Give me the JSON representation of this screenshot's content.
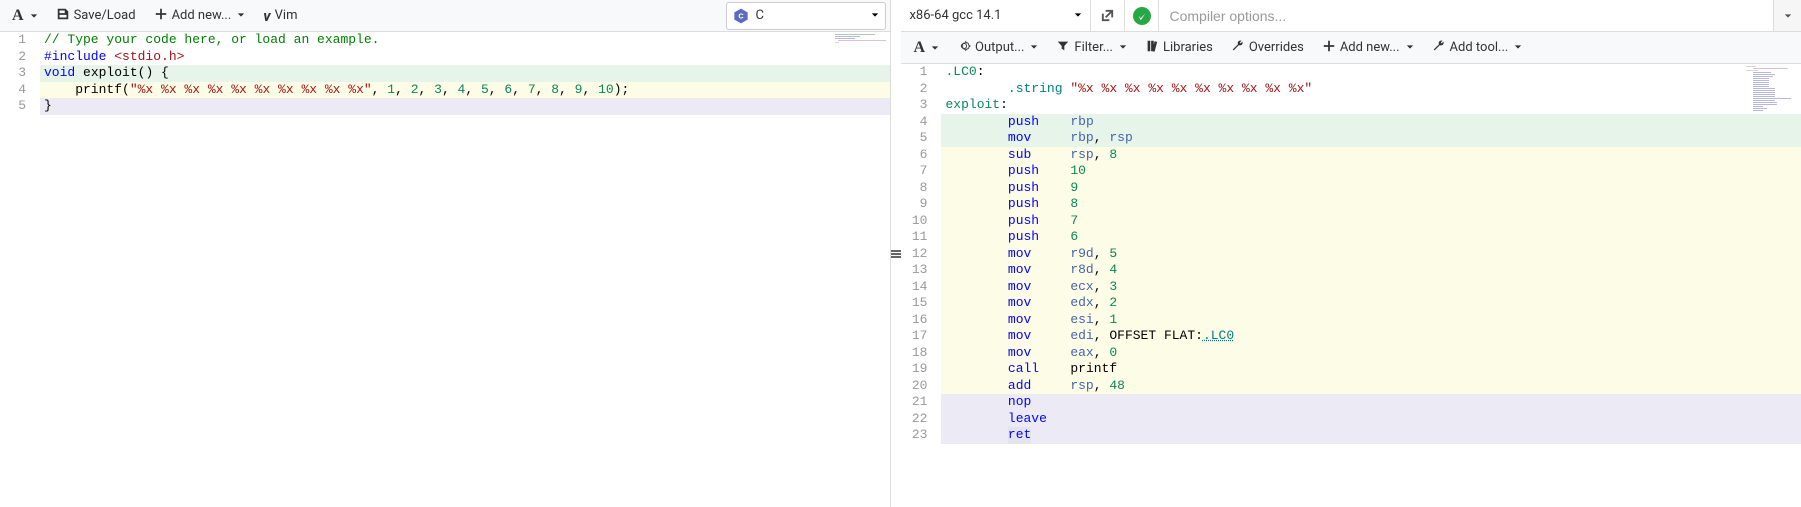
{
  "left": {
    "toolbar": {
      "font_label": "A",
      "saveload": "Save/Load",
      "addnew": "Add new...",
      "vim": "Vim"
    },
    "language": {
      "label": "C"
    },
    "code": {
      "lines": [
        {
          "n": 1,
          "bg": "",
          "tokens": [
            {
              "t": "// Type your code here, or load an example.",
              "c": "tok-comment"
            }
          ]
        },
        {
          "n": 2,
          "bg": "",
          "tokens": [
            {
              "t": "#include ",
              "c": "tok-pp"
            },
            {
              "t": "<stdio.h>",
              "c": "tok-ppfile"
            }
          ]
        },
        {
          "n": 3,
          "bg": "bg-green",
          "tokens": [
            {
              "t": "void",
              "c": "tok-type"
            },
            {
              "t": " ",
              "c": "tok-plain"
            },
            {
              "t": "exploit",
              "c": "tok-func"
            },
            {
              "t": "() {",
              "c": "tok-plain"
            }
          ]
        },
        {
          "n": 4,
          "bg": "bg-yellow",
          "tokens": [
            {
              "t": "    printf(",
              "c": "tok-plain"
            },
            {
              "t": "\"%x %x %x %x %x %x %x %x %x %x\"",
              "c": "tok-string"
            },
            {
              "t": ", ",
              "c": "tok-plain"
            },
            {
              "t": "1",
              "c": "tok-number"
            },
            {
              "t": ", ",
              "c": "tok-plain"
            },
            {
              "t": "2",
              "c": "tok-number"
            },
            {
              "t": ", ",
              "c": "tok-plain"
            },
            {
              "t": "3",
              "c": "tok-number"
            },
            {
              "t": ", ",
              "c": "tok-plain"
            },
            {
              "t": "4",
              "c": "tok-number"
            },
            {
              "t": ", ",
              "c": "tok-plain"
            },
            {
              "t": "5",
              "c": "tok-number"
            },
            {
              "t": ", ",
              "c": "tok-plain"
            },
            {
              "t": "6",
              "c": "tok-number"
            },
            {
              "t": ", ",
              "c": "tok-plain"
            },
            {
              "t": "7",
              "c": "tok-number"
            },
            {
              "t": ", ",
              "c": "tok-plain"
            },
            {
              "t": "8",
              "c": "tok-number"
            },
            {
              "t": ", ",
              "c": "tok-plain"
            },
            {
              "t": "9",
              "c": "tok-number"
            },
            {
              "t": ", ",
              "c": "tok-plain"
            },
            {
              "t": "10",
              "c": "tok-number"
            },
            {
              "t": ");",
              "c": "tok-plain"
            }
          ]
        },
        {
          "n": 5,
          "bg": "bg-purple",
          "tokens": [
            {
              "t": "}",
              "c": "tok-plain"
            }
          ]
        }
      ]
    }
  },
  "right": {
    "compiler": {
      "name": "x86-64 gcc 14.1",
      "options_placeholder": "Compiler options..."
    },
    "toolbar": {
      "font_label": "A",
      "output": "Output...",
      "filter": "Filter...",
      "libraries": "Libraries",
      "overrides": "Overrides",
      "addnew": "Add new...",
      "addtool": "Add tool..."
    },
    "asm": {
      "lines": [
        {
          "n": 1,
          "bg": "",
          "tokens": [
            {
              "t": ".LC0",
              "c": "tok-label"
            },
            {
              "t": ":",
              "c": "tok-plain"
            }
          ]
        },
        {
          "n": 2,
          "bg": "",
          "tokens": [
            {
              "t": "        ",
              "c": "tok-plain"
            },
            {
              "t": ".string",
              "c": "tok-dir"
            },
            {
              "t": " ",
              "c": "tok-plain"
            },
            {
              "t": "\"%x %x %x %x %x %x %x %x %x %x\"",
              "c": "tok-string"
            }
          ]
        },
        {
          "n": 3,
          "bg": "",
          "tokens": [
            {
              "t": "exploit",
              "c": "tok-label"
            },
            {
              "t": ":",
              "c": "tok-plain"
            }
          ]
        },
        {
          "n": 4,
          "bg": "bg-green",
          "tokens": [
            {
              "t": "        ",
              "c": "tok-plain"
            },
            {
              "t": "push",
              "c": "tok-instr"
            },
            {
              "t": "    ",
              "c": "tok-plain"
            },
            {
              "t": "rbp",
              "c": "tok-reg"
            }
          ]
        },
        {
          "n": 5,
          "bg": "bg-green",
          "tokens": [
            {
              "t": "        ",
              "c": "tok-plain"
            },
            {
              "t": "mov",
              "c": "tok-instr"
            },
            {
              "t": "     ",
              "c": "tok-plain"
            },
            {
              "t": "rbp",
              "c": "tok-reg"
            },
            {
              "t": ", ",
              "c": "tok-plain"
            },
            {
              "t": "rsp",
              "c": "tok-reg"
            }
          ]
        },
        {
          "n": 6,
          "bg": "bg-yellow",
          "tokens": [
            {
              "t": "        ",
              "c": "tok-plain"
            },
            {
              "t": "sub",
              "c": "tok-instr"
            },
            {
              "t": "     ",
              "c": "tok-plain"
            },
            {
              "t": "rsp",
              "c": "tok-reg"
            },
            {
              "t": ", ",
              "c": "tok-plain"
            },
            {
              "t": "8",
              "c": "tok-number"
            }
          ]
        },
        {
          "n": 7,
          "bg": "bg-yellow",
          "tokens": [
            {
              "t": "        ",
              "c": "tok-plain"
            },
            {
              "t": "push",
              "c": "tok-instr"
            },
            {
              "t": "    ",
              "c": "tok-plain"
            },
            {
              "t": "10",
              "c": "tok-number"
            }
          ]
        },
        {
          "n": 8,
          "bg": "bg-yellow",
          "tokens": [
            {
              "t": "        ",
              "c": "tok-plain"
            },
            {
              "t": "push",
              "c": "tok-instr"
            },
            {
              "t": "    ",
              "c": "tok-plain"
            },
            {
              "t": "9",
              "c": "tok-number"
            }
          ]
        },
        {
          "n": 9,
          "bg": "bg-yellow",
          "tokens": [
            {
              "t": "        ",
              "c": "tok-plain"
            },
            {
              "t": "push",
              "c": "tok-instr"
            },
            {
              "t": "    ",
              "c": "tok-plain"
            },
            {
              "t": "8",
              "c": "tok-number"
            }
          ]
        },
        {
          "n": 10,
          "bg": "bg-yellow",
          "tokens": [
            {
              "t": "        ",
              "c": "tok-plain"
            },
            {
              "t": "push",
              "c": "tok-instr"
            },
            {
              "t": "    ",
              "c": "tok-plain"
            },
            {
              "t": "7",
              "c": "tok-number"
            }
          ]
        },
        {
          "n": 11,
          "bg": "bg-yellow",
          "tokens": [
            {
              "t": "        ",
              "c": "tok-plain"
            },
            {
              "t": "push",
              "c": "tok-instr"
            },
            {
              "t": "    ",
              "c": "tok-plain"
            },
            {
              "t": "6",
              "c": "tok-number"
            }
          ]
        },
        {
          "n": 12,
          "bg": "bg-yellow",
          "tokens": [
            {
              "t": "        ",
              "c": "tok-plain"
            },
            {
              "t": "mov",
              "c": "tok-instr"
            },
            {
              "t": "     ",
              "c": "tok-plain"
            },
            {
              "t": "r9d",
              "c": "tok-reg"
            },
            {
              "t": ", ",
              "c": "tok-plain"
            },
            {
              "t": "5",
              "c": "tok-number"
            }
          ]
        },
        {
          "n": 13,
          "bg": "bg-yellow",
          "tokens": [
            {
              "t": "        ",
              "c": "tok-plain"
            },
            {
              "t": "mov",
              "c": "tok-instr"
            },
            {
              "t": "     ",
              "c": "tok-plain"
            },
            {
              "t": "r8d",
              "c": "tok-reg"
            },
            {
              "t": ", ",
              "c": "tok-plain"
            },
            {
              "t": "4",
              "c": "tok-number"
            }
          ]
        },
        {
          "n": 14,
          "bg": "bg-yellow",
          "tokens": [
            {
              "t": "        ",
              "c": "tok-plain"
            },
            {
              "t": "mov",
              "c": "tok-instr"
            },
            {
              "t": "     ",
              "c": "tok-plain"
            },
            {
              "t": "ecx",
              "c": "tok-reg"
            },
            {
              "t": ", ",
              "c": "tok-plain"
            },
            {
              "t": "3",
              "c": "tok-number"
            }
          ]
        },
        {
          "n": 15,
          "bg": "bg-yellow",
          "tokens": [
            {
              "t": "        ",
              "c": "tok-plain"
            },
            {
              "t": "mov",
              "c": "tok-instr"
            },
            {
              "t": "     ",
              "c": "tok-plain"
            },
            {
              "t": "edx",
              "c": "tok-reg"
            },
            {
              "t": ", ",
              "c": "tok-plain"
            },
            {
              "t": "2",
              "c": "tok-number"
            }
          ]
        },
        {
          "n": 16,
          "bg": "bg-yellow",
          "tokens": [
            {
              "t": "        ",
              "c": "tok-plain"
            },
            {
              "t": "mov",
              "c": "tok-instr"
            },
            {
              "t": "     ",
              "c": "tok-plain"
            },
            {
              "t": "esi",
              "c": "tok-reg"
            },
            {
              "t": ", ",
              "c": "tok-plain"
            },
            {
              "t": "1",
              "c": "tok-number"
            }
          ]
        },
        {
          "n": 17,
          "bg": "bg-yellow",
          "tokens": [
            {
              "t": "        ",
              "c": "tok-plain"
            },
            {
              "t": "mov",
              "c": "tok-instr"
            },
            {
              "t": "     ",
              "c": "tok-plain"
            },
            {
              "t": "edi",
              "c": "tok-reg"
            },
            {
              "t": ", OFFSET FLAT:",
              "c": "tok-plain"
            },
            {
              "t": ".LC0",
              "c": "tok-link"
            }
          ]
        },
        {
          "n": 18,
          "bg": "bg-yellow",
          "tokens": [
            {
              "t": "        ",
              "c": "tok-plain"
            },
            {
              "t": "mov",
              "c": "tok-instr"
            },
            {
              "t": "     ",
              "c": "tok-plain"
            },
            {
              "t": "eax",
              "c": "tok-reg"
            },
            {
              "t": ", ",
              "c": "tok-plain"
            },
            {
              "t": "0",
              "c": "tok-number"
            }
          ]
        },
        {
          "n": 19,
          "bg": "bg-yellow",
          "tokens": [
            {
              "t": "        ",
              "c": "tok-plain"
            },
            {
              "t": "call",
              "c": "tok-instr"
            },
            {
              "t": "    ",
              "c": "tok-plain"
            },
            {
              "t": "printf",
              "c": "tok-plain"
            }
          ]
        },
        {
          "n": 20,
          "bg": "bg-yellow",
          "tokens": [
            {
              "t": "        ",
              "c": "tok-plain"
            },
            {
              "t": "add",
              "c": "tok-instr"
            },
            {
              "t": "     ",
              "c": "tok-plain"
            },
            {
              "t": "rsp",
              "c": "tok-reg"
            },
            {
              "t": ", ",
              "c": "tok-plain"
            },
            {
              "t": "48",
              "c": "tok-number"
            }
          ]
        },
        {
          "n": 21,
          "bg": "bg-purple",
          "tokens": [
            {
              "t": "        ",
              "c": "tok-plain"
            },
            {
              "t": "nop",
              "c": "tok-instr"
            }
          ]
        },
        {
          "n": 22,
          "bg": "bg-purple",
          "tokens": [
            {
              "t": "        ",
              "c": "tok-plain"
            },
            {
              "t": "leave",
              "c": "tok-instr"
            }
          ]
        },
        {
          "n": 23,
          "bg": "bg-purple",
          "tokens": [
            {
              "t": "        ",
              "c": "tok-plain"
            },
            {
              "t": "ret",
              "c": "tok-instr",
              "sel": true
            }
          ]
        }
      ]
    }
  }
}
